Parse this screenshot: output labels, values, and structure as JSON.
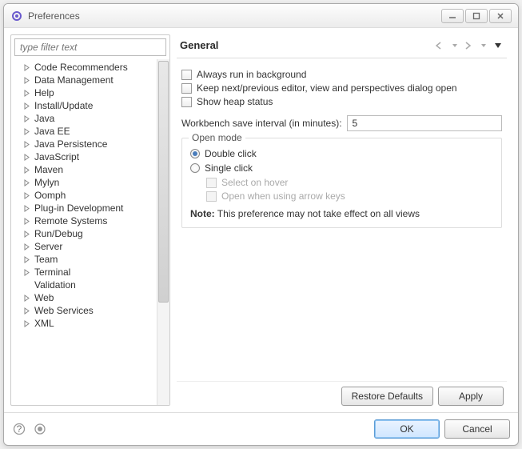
{
  "window": {
    "title": "Preferences"
  },
  "filter": {
    "placeholder": "type filter text"
  },
  "tree": [
    {
      "label": "Code Recommenders",
      "exp": true
    },
    {
      "label": "Data Management",
      "exp": true
    },
    {
      "label": "Help",
      "exp": true
    },
    {
      "label": "Install/Update",
      "exp": true
    },
    {
      "label": "Java",
      "exp": true
    },
    {
      "label": "Java EE",
      "exp": true
    },
    {
      "label": "Java Persistence",
      "exp": true
    },
    {
      "label": "JavaScript",
      "exp": true
    },
    {
      "label": "Maven",
      "exp": true
    },
    {
      "label": "Mylyn",
      "exp": true
    },
    {
      "label": "Oomph",
      "exp": true
    },
    {
      "label": "Plug-in Development",
      "exp": true
    },
    {
      "label": "Remote Systems",
      "exp": true
    },
    {
      "label": "Run/Debug",
      "exp": true
    },
    {
      "label": "Server",
      "exp": true
    },
    {
      "label": "Team",
      "exp": true
    },
    {
      "label": "Terminal",
      "exp": true
    },
    {
      "label": "Validation",
      "exp": false
    },
    {
      "label": "Web",
      "exp": true
    },
    {
      "label": "Web Services",
      "exp": true
    },
    {
      "label": "XML",
      "exp": true
    }
  ],
  "page": {
    "heading": "General",
    "chk1": "Always run in background",
    "chk2": "Keep next/previous editor, view and perspectives dialog open",
    "chk3": "Show heap status",
    "interval_label": "Workbench save interval (in minutes):",
    "interval_value": "5",
    "group_title": "Open mode",
    "radio1": "Double click",
    "radio2": "Single click",
    "sub1": "Select on hover",
    "sub2": "Open when using arrow keys",
    "note_prefix": "Note:",
    "note_text": " This preference may not take effect on all views"
  },
  "buttons": {
    "restore": "Restore Defaults",
    "apply": "Apply",
    "ok": "OK",
    "cancel": "Cancel"
  }
}
